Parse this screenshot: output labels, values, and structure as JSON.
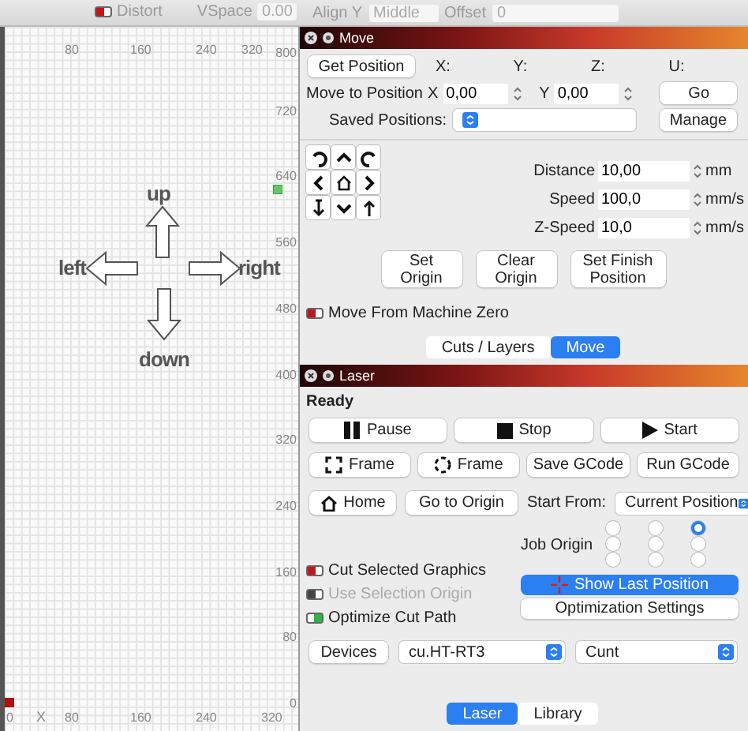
{
  "toolbar": {
    "distort": {
      "label": "Distort",
      "on": false
    },
    "vspace": {
      "label": "VSpace",
      "value": "0.00"
    },
    "align_y": {
      "label": "Align Y",
      "value": "Middle"
    },
    "offset": {
      "label": "Offset",
      "value": "0"
    }
  },
  "canvas": {
    "top_ruler": [
      "80",
      "160",
      "240",
      "320"
    ],
    "right_ruler": [
      "800",
      "720",
      "640",
      "560",
      "480",
      "400",
      "320",
      "240",
      "160",
      "80",
      "0"
    ],
    "bottom_ruler": [
      "0",
      "80",
      "160",
      "240",
      "320"
    ],
    "axis_label": "X",
    "shapes": [
      {
        "label": "up"
      },
      {
        "label": "left"
      },
      {
        "label": "right"
      },
      {
        "label": "down"
      }
    ]
  },
  "move_panel": {
    "title": "Move",
    "get_position": "Get Position",
    "axes": [
      "X:",
      "Y:",
      "Z:",
      "U:"
    ],
    "move_to_label": "Move to Position",
    "fields": [
      {
        "label": "X",
        "value": "0,00"
      },
      {
        "label": "Y",
        "value": "0,00"
      }
    ],
    "go": "Go",
    "saved_label": "Saved Positions:",
    "manage": "Manage",
    "jog": [
      {
        "kind": "ccw"
      },
      {
        "kind": "up"
      },
      {
        "kind": "cw"
      },
      {
        "kind": "left"
      },
      {
        "kind": "home"
      },
      {
        "kind": "right"
      },
      {
        "kind": "z-down"
      },
      {
        "kind": "down"
      },
      {
        "kind": "z-up"
      }
    ],
    "settings": [
      {
        "label": "Distance",
        "value": "10,00",
        "unit": "mm"
      },
      {
        "label": "Speed",
        "value": "100,0",
        "unit": "mm/s"
      },
      {
        "label": "Z-Speed",
        "value": "10,0",
        "unit": "mm/s"
      }
    ],
    "origin_buttons": [
      "Set Origin",
      "Clear Origin",
      "Set Finish Position"
    ],
    "machine_zero": {
      "label": "Move From Machine Zero",
      "on": false,
      "disabled": false
    },
    "tabs": [
      {
        "label": "Cuts / Layers",
        "selected": false
      },
      {
        "label": "Move",
        "selected": true
      }
    ]
  },
  "laser_panel": {
    "title": "Laser",
    "status": "Ready",
    "button_rows": [
      [
        {
          "label": "Pause",
          "kind": "pause"
        },
        {
          "label": "Stop",
          "kind": "stop"
        },
        {
          "label": "Start",
          "kind": "start"
        }
      ],
      [
        {
          "label": "Frame",
          "kind": "frame-rect"
        },
        {
          "label": "Frame",
          "kind": "frame-circle"
        },
        {
          "label": "Save GCode",
          "kind": "plain"
        },
        {
          "label": "Run GCode",
          "kind": "plain"
        }
      ]
    ],
    "home": "Home",
    "go_to_origin": "Go to Origin",
    "start_from_label": "Start From:",
    "start_from": "Current Position",
    "job_origin_label": "Job Origin",
    "job_origin": [
      {
        "selected": false
      },
      {
        "selected": false
      },
      {
        "selected": true
      },
      {
        "selected": false
      },
      {
        "selected": false
      },
      {
        "selected": false
      },
      {
        "selected": false
      },
      {
        "selected": false
      },
      {
        "selected": false
      }
    ],
    "toggles": [
      {
        "label": "Cut Selected Graphics",
        "on": false,
        "disabled": false
      },
      {
        "label": "Use Selection Origin",
        "on": false,
        "disabled": true
      },
      {
        "label": "Optimize Cut Path",
        "on": true,
        "disabled": false
      }
    ],
    "show_last_position": "Show Last Position",
    "optimization_settings": "Optimization Settings",
    "devices": "Devices",
    "port": "cu.HT-RT3",
    "device": "Cunt",
    "tabs": [
      {
        "label": "Laser",
        "selected": true
      },
      {
        "label": "Library",
        "selected": false
      }
    ]
  }
}
